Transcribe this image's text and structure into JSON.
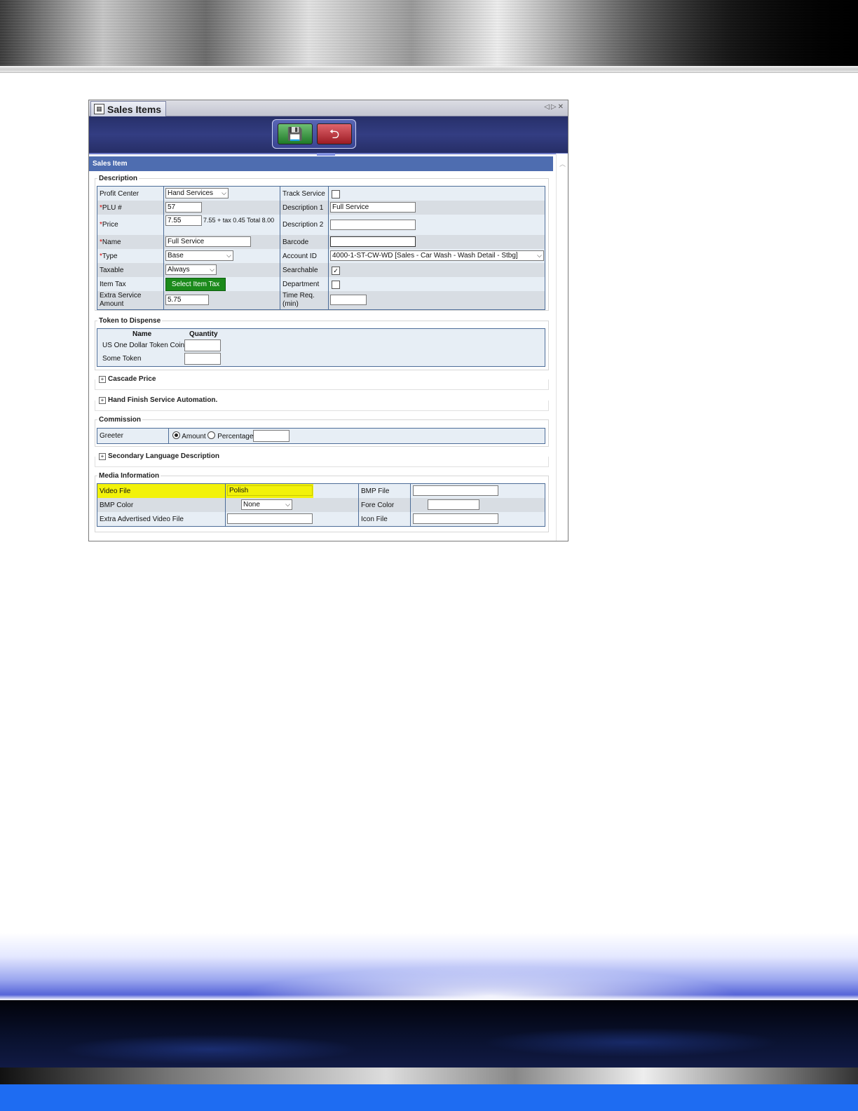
{
  "window": {
    "title": "Sales Items"
  },
  "section_title": "Sales Item",
  "description": {
    "legend": "Description",
    "profit_center": {
      "label": "Profit Center",
      "value": "Hand Services"
    },
    "plu": {
      "required": "*",
      "label": "PLU #",
      "value": "57"
    },
    "price": {
      "required": "*",
      "label": "Price",
      "value": "7.55",
      "summary": "7.55 + tax 0.45 Total 8.00"
    },
    "name": {
      "required": "*",
      "label": "Name",
      "value": "Full Service"
    },
    "type": {
      "required": "*",
      "label": "Type",
      "value": "Base"
    },
    "taxable": {
      "label": "Taxable",
      "value": "Always"
    },
    "item_tax": {
      "label": "Item Tax",
      "button": "Select Item Tax"
    },
    "extra_service": {
      "label_1": "Extra Service",
      "label_2": "Amount",
      "value": "5.75"
    },
    "track_service": {
      "label": "Track Service",
      "checked": false
    },
    "description_1": {
      "label": "Description 1",
      "value": "Full Service"
    },
    "description_2": {
      "label": "Description 2",
      "value": ""
    },
    "barcode": {
      "label": "Barcode",
      "value": ""
    },
    "account_id": {
      "label": "Account ID",
      "value": "4000-1-ST-CW-WD [Sales - Car Wash - Wash Detail - Stbg]"
    },
    "searchable": {
      "label": "Searchable",
      "checked": true,
      "mark": "✓"
    },
    "department": {
      "label": "Department",
      "checked": false
    },
    "time_req": {
      "label_1": "Time Req.",
      "label_2": "(min)",
      "value": ""
    }
  },
  "token": {
    "legend": "Token to Dispense",
    "col_name": "Name",
    "col_quantity": "Quantity",
    "rows": [
      {
        "name": "US One Dollar Token Coin",
        "quantity": ""
      },
      {
        "name": "Some Token",
        "quantity": ""
      }
    ]
  },
  "cascade_price": {
    "label": "Cascade Price",
    "toggle": "+"
  },
  "hand_finish": {
    "label": "Hand Finish Service Automation.",
    "toggle": "+"
  },
  "commission": {
    "legend": "Commission",
    "greeter_label": "Greeter",
    "amount_label": "Amount",
    "percentage_label": "Percentage",
    "selected": "Amount",
    "value": ""
  },
  "secondary_language": {
    "label": "Secondary Language Description",
    "toggle": "+"
  },
  "media": {
    "legend": "Media Information",
    "video_file": {
      "label": "Video File",
      "value": "Polish"
    },
    "bmp_color": {
      "label": "BMP Color",
      "value": "None"
    },
    "extra_video": {
      "label": "Extra Advertised Video File",
      "value": ""
    },
    "bmp_file": {
      "label": "BMP File",
      "value": ""
    },
    "fore_color": {
      "label": "Fore Color",
      "value": ""
    },
    "icon_file": {
      "label": "Icon File",
      "value": ""
    }
  },
  "colors": {
    "header_blue": "#4e6db0",
    "grid_border": "#4d6d98",
    "highlight": "#f2f20a",
    "green_button": "#1b8a1b"
  }
}
